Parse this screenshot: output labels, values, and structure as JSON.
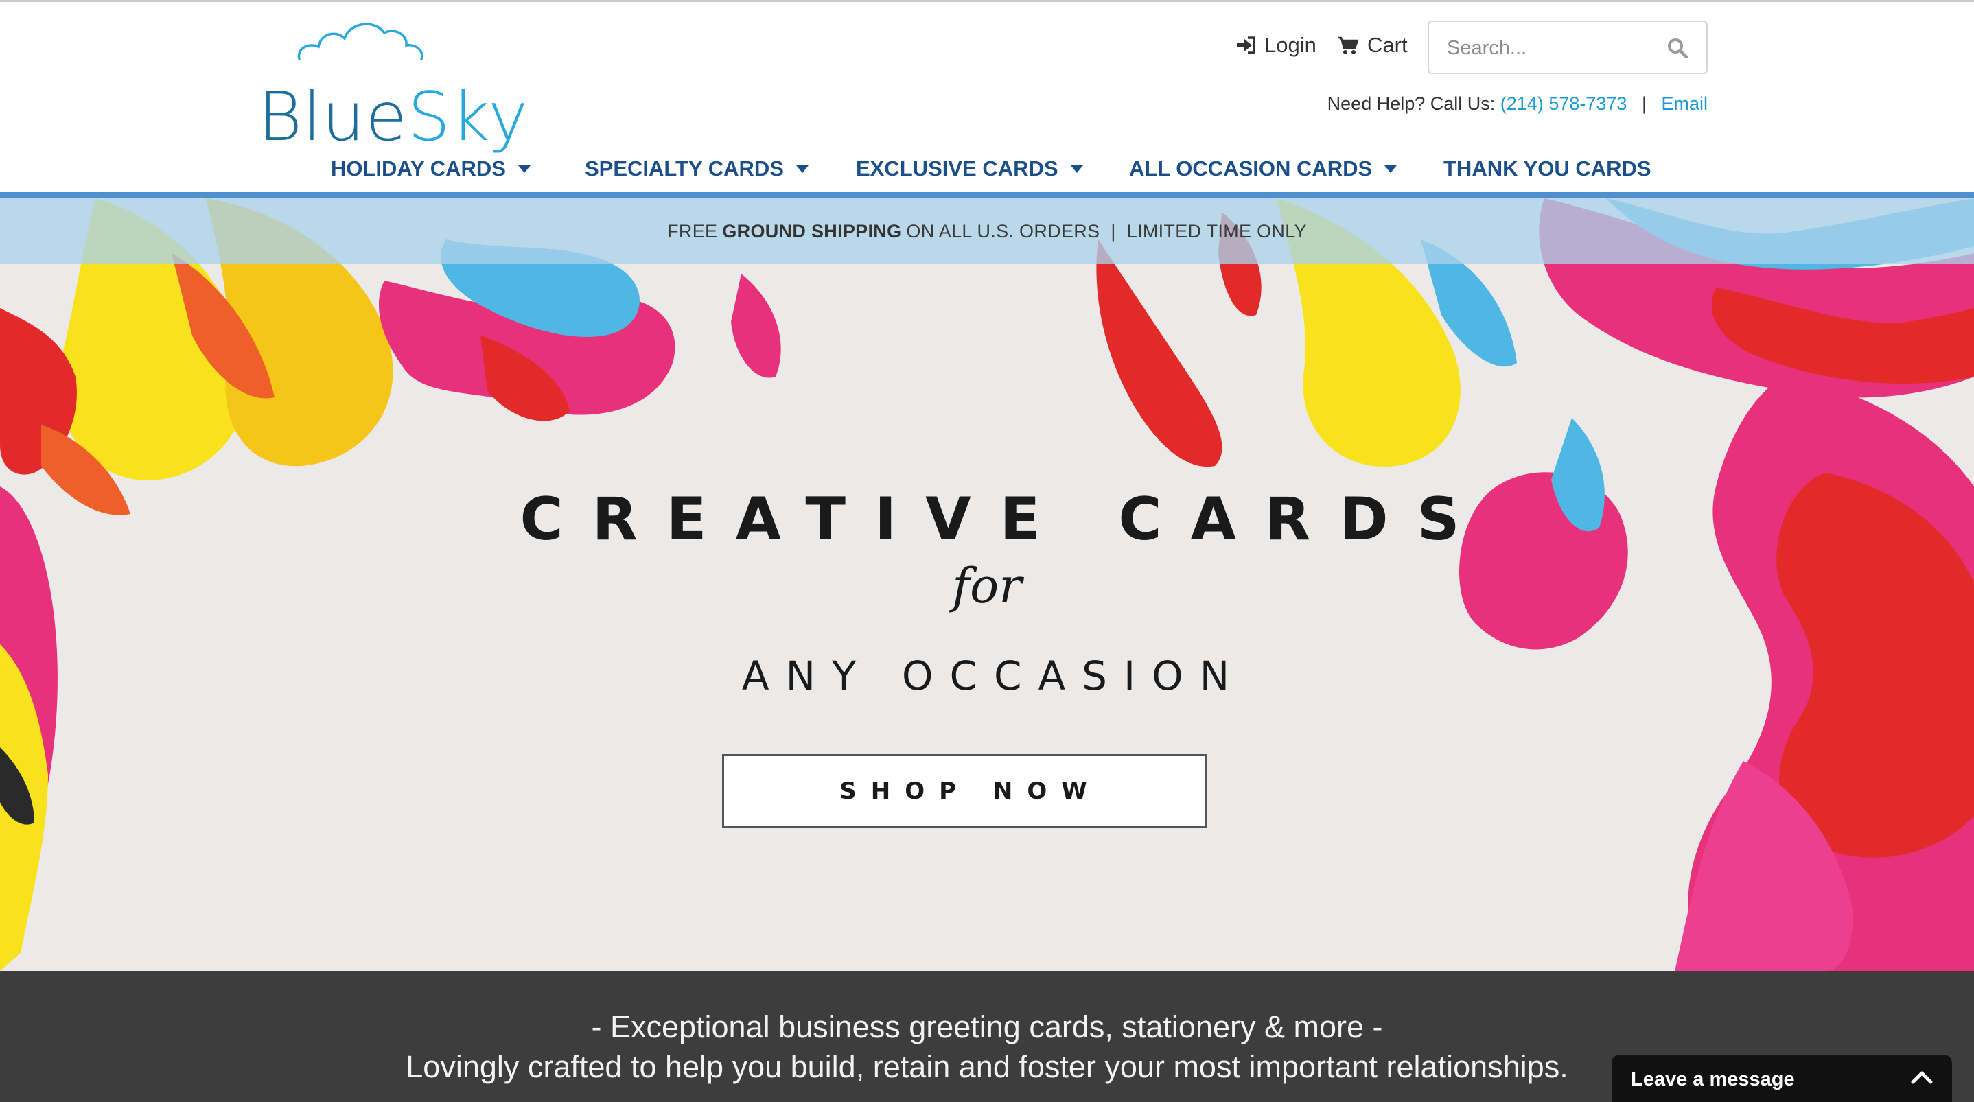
{
  "brand": {
    "logo_part1": "Blue",
    "logo_part2": "Sky"
  },
  "header": {
    "login_label": "Login",
    "cart_label": "Cart",
    "search_placeholder": "Search...",
    "help_prefix": "Need Help? Call Us:",
    "phone": "(214) 578-7373",
    "separator": "|",
    "email_label": "Email"
  },
  "nav": {
    "items": [
      {
        "label": "HOLIDAY CARDS"
      },
      {
        "label": "SPECIALTY CARDS"
      },
      {
        "label": "EXCLUSIVE CARDS"
      },
      {
        "label": "ALL OCCASION CARDS"
      },
      {
        "label": "THANK YOU CARDS"
      }
    ]
  },
  "promo": {
    "free": "FREE",
    "ground": "GROUND SHIPPING",
    "rest": "ON ALL U.S. ORDERS",
    "separator": "|",
    "limited": "LIMITED TIME ONLY"
  },
  "hero": {
    "title": "CREATIVE CARDS",
    "for": "for",
    "subtitle": "ANY OCCASION",
    "button": "SHOP NOW"
  },
  "tagline": {
    "line1": "- Exceptional business greeting cards, stationery & more -",
    "line2": "Lovingly crafted to help you build, retain and foster your most important relationships."
  },
  "chat": {
    "label": "Leave a message"
  },
  "colors": {
    "nav_text": "#1b4f8a",
    "link": "#1b9ad4",
    "nav_bar": "#4e8fd0",
    "dark_band": "#3d3d3d"
  }
}
